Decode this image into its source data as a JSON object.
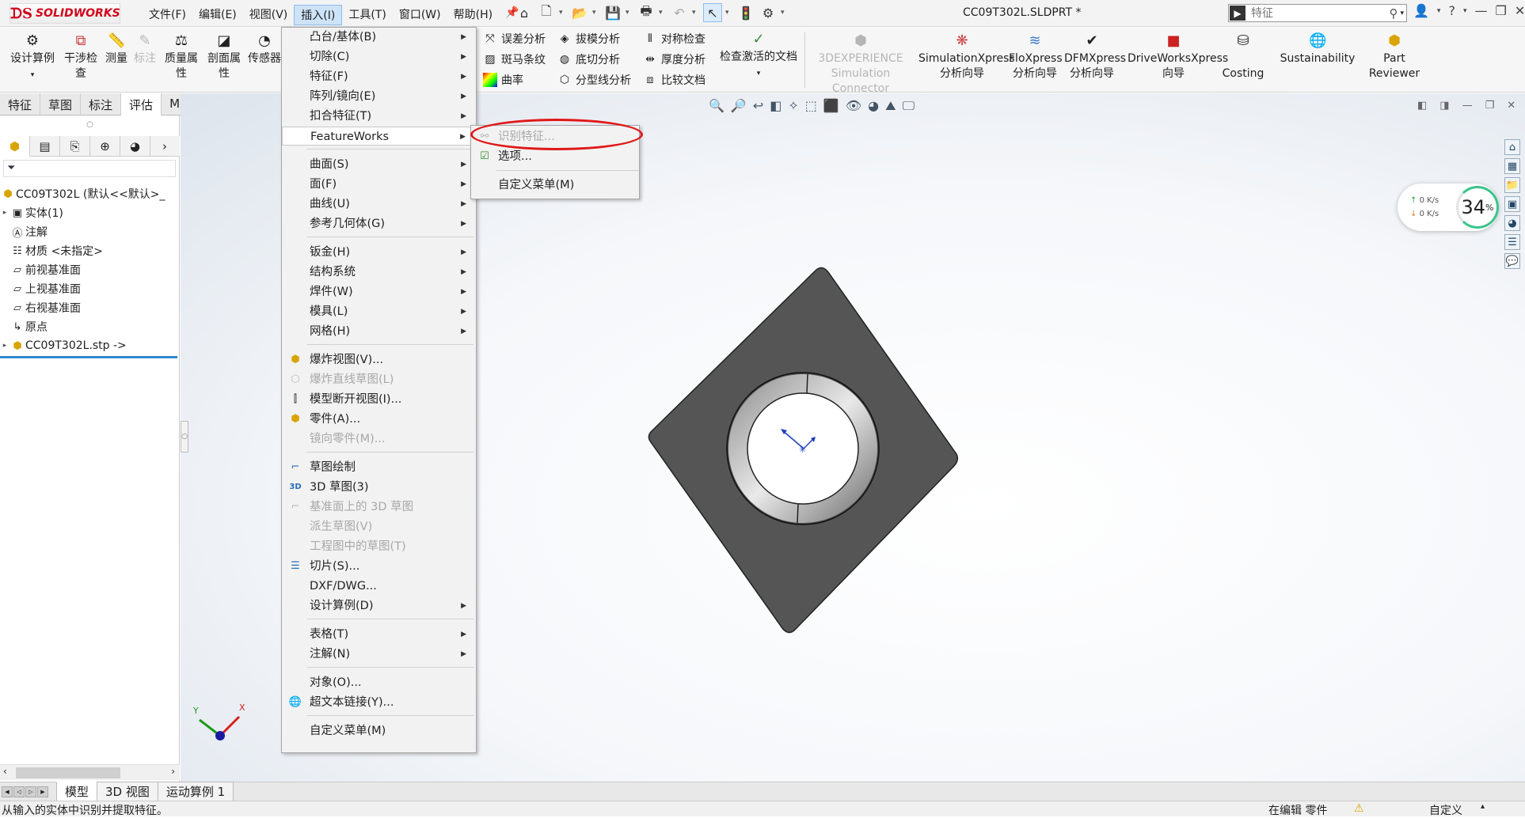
{
  "app": {
    "brand": "SOLIDWORKS",
    "doc_title": "CC09T302L.SLDPRT *"
  },
  "menubar": [
    "文件(F)",
    "编辑(E)",
    "视图(V)",
    "插入(I)",
    "工具(T)",
    "窗口(W)",
    "帮助(H)"
  ],
  "search": {
    "placeholder": "特征"
  },
  "ribbon": {
    "design_study": "设计算例",
    "interference": [
      "干涉检",
      "查"
    ],
    "measure": "测量",
    "markup": "标注",
    "mass_props": [
      "质量属",
      "性"
    ],
    "section_props": [
      "剖面属",
      "性"
    ],
    "sensor": "传感器",
    "deviation": "误差分析",
    "draft": "拔模分析",
    "symmetry": "对称检查",
    "zebra": "斑马条纹",
    "undercut": "底切分析",
    "thickness": "厚度分析",
    "curvature": "曲率",
    "parting": "分型线分析",
    "compare": "比较文档",
    "check_active": "检查激活的文档",
    "dx_sim": [
      "3DEXPERIENCE",
      "Simulation Connector"
    ],
    "simxpress": [
      "SimulationXpress",
      "分析向导"
    ],
    "floxpress": [
      "FloXpress",
      "分析向导"
    ],
    "dfmxpress": [
      "DFMXpress",
      "分析向导"
    ],
    "driveworks": [
      "DriveWorksXpress",
      "向导"
    ],
    "costing": "Costing",
    "sustainability": "Sustainability",
    "part_reviewer": [
      "Part",
      "Reviewer"
    ]
  },
  "cm_tabs": [
    "特征",
    "草图",
    "标注",
    "评估",
    "MBD Dimensions"
  ],
  "tree": [
    {
      "label": "CC09T302L  (默认<<默认>_",
      "icon": "part-icon",
      "toggle": ""
    },
    {
      "label": "实体(1)",
      "icon": "solid-bodies-icon",
      "toggle": "▸"
    },
    {
      "label": "注解",
      "icon": "annotations-icon",
      "toggle": ""
    },
    {
      "label": "材质 <未指定>",
      "icon": "material-icon",
      "toggle": ""
    },
    {
      "label": "前视基准面",
      "icon": "plane-icon",
      "toggle": ""
    },
    {
      "label": "上视基准面",
      "icon": "plane-icon",
      "toggle": ""
    },
    {
      "label": "右视基准面",
      "icon": "plane-icon",
      "toggle": ""
    },
    {
      "label": "原点",
      "icon": "origin-icon",
      "toggle": ""
    },
    {
      "label": "CC09T302L.stp ->",
      "icon": "imported-feature-icon",
      "toggle": "▸"
    }
  ],
  "insert_menu": [
    {
      "label": "凸台/基体(B)",
      "arrow": true
    },
    {
      "label": "切除(C)",
      "arrow": true
    },
    {
      "label": "特征(F)",
      "arrow": true
    },
    {
      "label": "阵列/镜向(E)",
      "arrow": true
    },
    {
      "label": "扣合特征(T)",
      "arrow": true
    },
    {
      "label": "FeatureWorks",
      "arrow": true,
      "highlight": true
    },
    {
      "label": "曲面(S)",
      "arrow": true
    },
    {
      "label": "面(F)",
      "arrow": true
    },
    {
      "label": "曲线(U)",
      "arrow": true
    },
    {
      "label": "参考几何体(G)",
      "arrow": true
    },
    {
      "label": "钣金(H)",
      "arrow": true
    },
    {
      "label": "结构系统",
      "arrow": true
    },
    {
      "label": "焊件(W)",
      "arrow": true
    },
    {
      "label": "模具(L)",
      "arrow": true
    },
    {
      "label": "网格(H)",
      "arrow": true
    },
    {
      "label": "爆炸视图(V)...",
      "icon": "exploded-view-icon"
    },
    {
      "label": "爆炸直线草图(L)",
      "disabled": true,
      "icon": "explode-line-icon"
    },
    {
      "label": "模型断开视图(I)...",
      "icon": "break-view-icon"
    },
    {
      "label": "零件(A)...",
      "icon": "insert-part-icon"
    },
    {
      "label": "镜向零件(M)...",
      "disabled": true
    },
    {
      "label": "草图绘制",
      "icon": "sketch-icon"
    },
    {
      "label": "3D 草图(3)",
      "icon": "3d-sketch-icon"
    },
    {
      "label": "基准面上的 3D 草图",
      "disabled": true,
      "icon": "3d-sketch-plane-icon"
    },
    {
      "label": "派生草图(V)",
      "disabled": true
    },
    {
      "label": "工程图中的草图(T)",
      "disabled": true
    },
    {
      "label": "切片(S)...",
      "icon": "slice-icon"
    },
    {
      "label": "DXF/DWG..."
    },
    {
      "label": "设计算例(D)",
      "arrow": true
    },
    {
      "label": "表格(T)",
      "arrow": true
    },
    {
      "label": "注解(N)",
      "arrow": true
    },
    {
      "label": "对象(O)..."
    },
    {
      "label": "超文本链接(Y)...",
      "icon": "hyperlink-icon"
    },
    {
      "label": "自定义菜单(M)"
    }
  ],
  "featureworks_menu": [
    {
      "label": "识别特征...",
      "disabled": true
    },
    {
      "label": "选项..."
    },
    {
      "label": "自定义菜单(M)"
    }
  ],
  "net_widget": {
    "up": "0   K/s",
    "down": "0   K/s",
    "percent": "34",
    "unit": "%"
  },
  "triad": {
    "x": "X",
    "y": "Y"
  },
  "bottom_tabs": [
    "模型",
    "3D 视图",
    "运动算例 1"
  ],
  "status": {
    "left": "从输入的实体中识别并提取特征。",
    "mode": "在编辑 零件",
    "custom": "自定义"
  },
  "colors": {
    "brand_red": "#d0021b",
    "annotation_red": "#e01818",
    "model_gray": "#555555"
  }
}
